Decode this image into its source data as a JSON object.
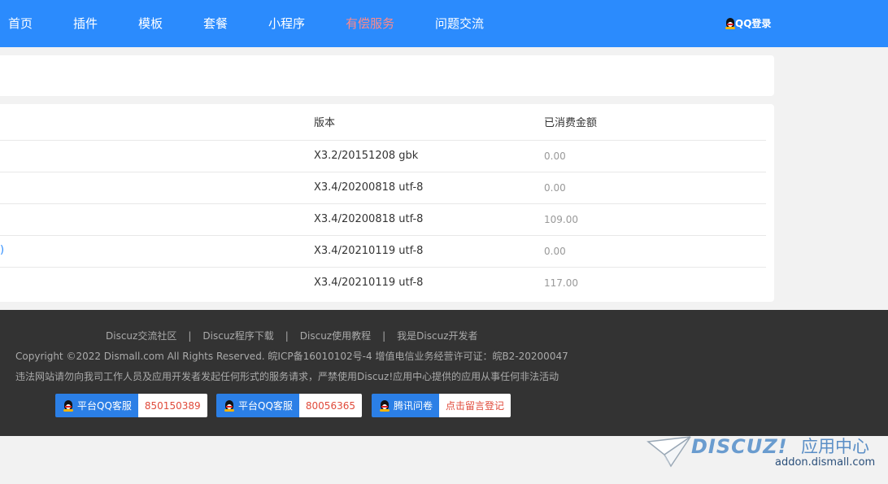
{
  "nav": {
    "items": [
      "首页",
      "插件",
      "模板",
      "套餐",
      "小程序",
      "有偿服务",
      "问题交流"
    ],
    "highlight_index": 5,
    "login_label": "QQ登录"
  },
  "table": {
    "headers": {
      "version": "版本",
      "amount": "已消费金额"
    },
    "rows": [
      {
        "edge": "",
        "version": "X3.2/20151208 gbk",
        "amount": "0.00"
      },
      {
        "edge": "",
        "version": "X3.4/20200818 utf-8",
        "amount": "0.00"
      },
      {
        "edge": "",
        "version": "X3.4/20200818 utf-8",
        "amount": "109.00"
      },
      {
        "edge": ")",
        "version": "X3.4/20210119 utf-8",
        "amount": "0.00"
      },
      {
        "edge": "",
        "version": "X3.4/20210119 utf-8",
        "amount": "117.00"
      }
    ]
  },
  "footer": {
    "links": [
      "Discuz交流社区",
      "Discuz程序下载",
      "Discuz使用教程",
      "我是Discuz开发者"
    ],
    "separator": "|",
    "copyright": "Copyright ©2022 Dismall.com All Rights Reserved. 皖ICP备16010102号-4  增值电信业务经营许可证：皖B2-20200047",
    "notice": "违法网站请勿向我司工作人员及应用开发者发起任何形式的服务请求，严禁使用Discuz!应用中心提供的应用从事任何非法活动",
    "services": [
      {
        "label": "平台QQ客服",
        "value": "850150389"
      },
      {
        "label": "平台QQ客服",
        "value": "80056365"
      },
      {
        "label": "腾讯问卷",
        "value": "点击留言登记"
      }
    ]
  },
  "brand": {
    "logo": "DISCUZ!",
    "cn": "应用中心",
    "url": "addon.dismall.com"
  },
  "colors": {
    "nav_bg": "#2b8bfd",
    "nav_highlight": "#ff8a8a",
    "footer_bg": "#333333",
    "service_label_bg": "#2b7fe6",
    "service_value_text": "#e04a3a"
  }
}
